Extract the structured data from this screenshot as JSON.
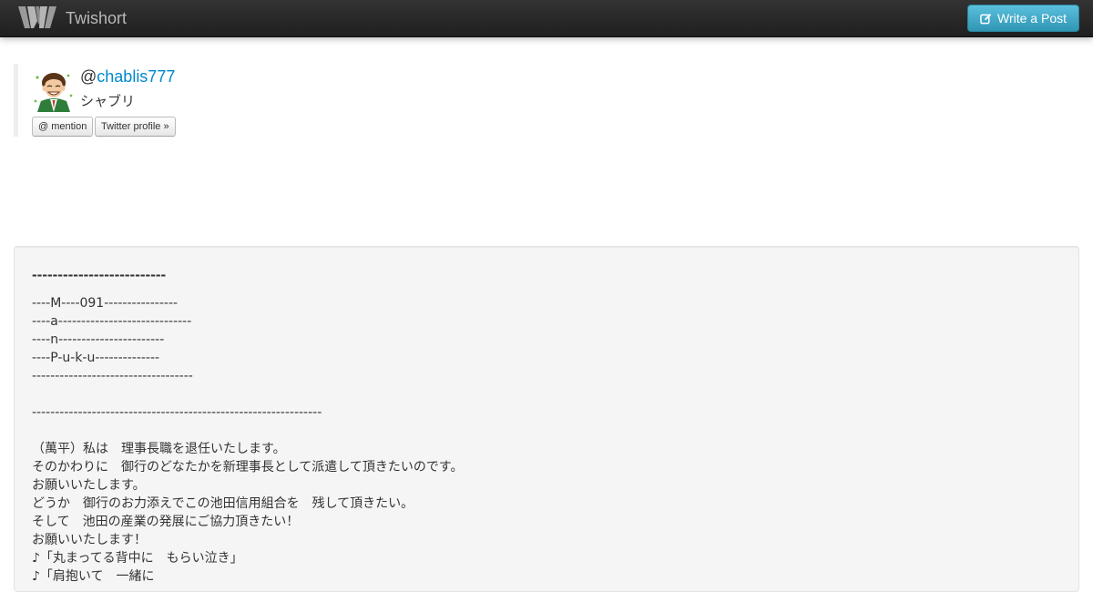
{
  "navbar": {
    "brand_name": "Twishort",
    "logo_icon": "twishort-logo-icon",
    "write_post_label": "Write a Post",
    "write_post_icon": "edit-icon"
  },
  "profile": {
    "at_sign": "@",
    "username": "chablis777",
    "display_name": "シャブリ",
    "mention_button": "@ mention",
    "twitter_profile_button": "Twitter profile »"
  },
  "post": {
    "title": "--------------------------",
    "lines": [
      "----M----091----------------",
      "----a-----------------------------",
      "----n-----------------------",
      "----P-u-k-u--------------",
      "-----------------------------------",
      "",
      "---------------------------------------------------------------",
      "",
      "（萬平）私は　理事長職を退任いたします。",
      "そのかわりに　御行のどなたかを新理事長として派遣して頂きたいのです。",
      "お願いいたします。",
      "どうか　御行のお力添えでこの池田信用組合を　残して頂きたい。",
      "そして　池田の産業の発展にご協力頂きたい！",
      "お願いいたします！",
      "♪「丸まってる背中に　もらい泣き」",
      "♪「肩抱いて　一緒に"
    ]
  }
}
